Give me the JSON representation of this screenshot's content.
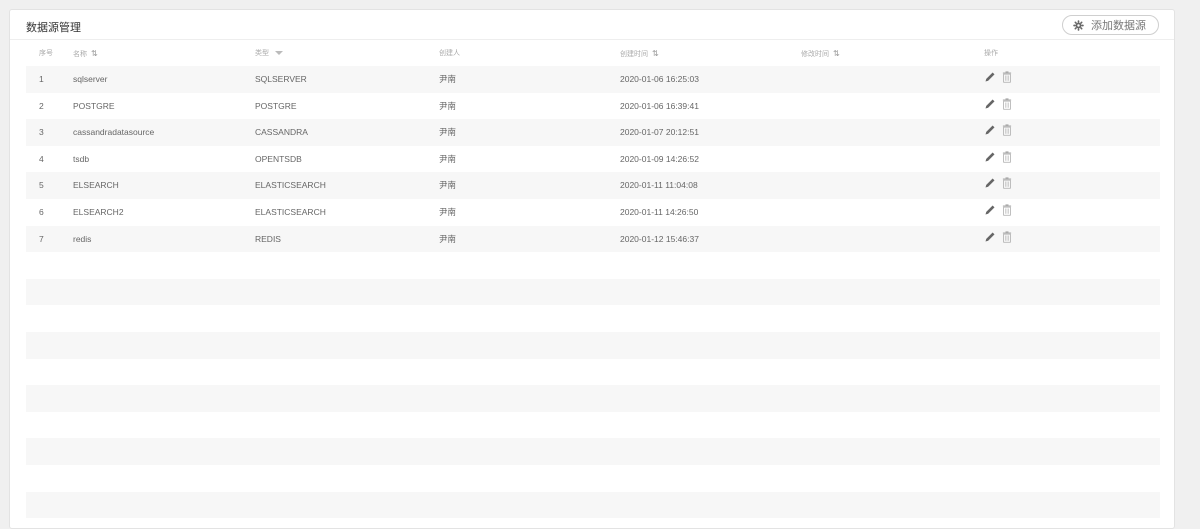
{
  "panel": {
    "title": "数据源管理",
    "add_button_label": "添加数据源",
    "add_button_icon": "gear-icon"
  },
  "table": {
    "columns": [
      "序号",
      "名称",
      "类型",
      "创建人",
      "创建时间",
      "修改时间",
      "操作"
    ],
    "sortable_columns": [
      "名称",
      "创建时间",
      "修改时间"
    ],
    "filter_columns": [
      "类型"
    ],
    "row_actions": [
      "edit-icon",
      "delete-icon"
    ],
    "rows": [
      {
        "index": "1",
        "name": "sqlserver",
        "type": "SQLSERVER",
        "creator": "尹南",
        "created": "2020-01-06 16:25:03",
        "modified": ""
      },
      {
        "index": "2",
        "name": "POSTGRE",
        "type": "POSTGRE",
        "creator": "尹南",
        "created": "2020-01-06 16:39:41",
        "modified": ""
      },
      {
        "index": "3",
        "name": "cassandradatasource",
        "type": "CASSANDRA",
        "creator": "尹南",
        "created": "2020-01-07 20:12:51",
        "modified": ""
      },
      {
        "index": "4",
        "name": "tsdb",
        "type": "OPENTSDB",
        "creator": "尹南",
        "created": "2020-01-09 14:26:52",
        "modified": ""
      },
      {
        "index": "5",
        "name": "ELSEARCH",
        "type": "ELASTICSEARCH",
        "creator": "尹南",
        "created": "2020-01-11 11:04:08",
        "modified": ""
      },
      {
        "index": "6",
        "name": "ELSEARCH2",
        "type": "ELASTICSEARCH",
        "creator": "尹南",
        "created": "2020-01-11 14:26:50",
        "modified": ""
      },
      {
        "index": "7",
        "name": "redis",
        "type": "REDIS",
        "creator": "尹南",
        "created": "2020-01-12 15:46:37",
        "modified": ""
      }
    ]
  }
}
